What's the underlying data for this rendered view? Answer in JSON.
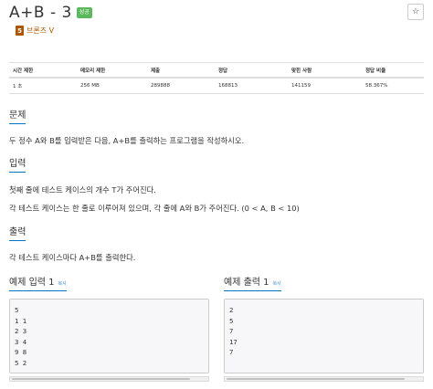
{
  "header": {
    "title": "A+B - 3",
    "badge": "성공",
    "star_icon": "☆"
  },
  "tier": {
    "icon_letter": "5",
    "label": "브론즈 V"
  },
  "info_table": {
    "headers": [
      "시간 제한",
      "메모리 제한",
      "제출",
      "정답",
      "맞힌 사람",
      "정답 비율"
    ],
    "values": [
      "1 초",
      "256 MB",
      "289888",
      "168813",
      "141159",
      "58.367%"
    ]
  },
  "problem": {
    "heading": "문제",
    "text": "두 정수 A와 B를 입력받은 다음, A+B를 출력하는 프로그램을 작성하시오."
  },
  "input": {
    "heading": "입력",
    "line1": "첫째 줄에 테스트 케이스의 개수 T가 주어진다.",
    "line2": "각 테스트 케이스는 한 줄로 이루어져 있으며, 각 줄에 A와 B가 주어진다. (0 < A, B < 10)"
  },
  "output": {
    "heading": "출력",
    "text": "각 테스트 케이스마다 A+B를 출력한다."
  },
  "example_input": {
    "heading": "예제 입력 1",
    "copy_label": "복사",
    "lines": [
      "5",
      "1 1",
      "2 3",
      "3 4",
      "9 8",
      "5 2"
    ]
  },
  "example_output": {
    "heading": "예제 출력 1",
    "copy_label": "복사",
    "lines": [
      "2",
      "5",
      "7",
      "17",
      "7"
    ]
  },
  "colors": {
    "accent": "#0076c0",
    "badge": "#5cb85c",
    "bronze": "#ad5600",
    "link": "#428bca"
  }
}
